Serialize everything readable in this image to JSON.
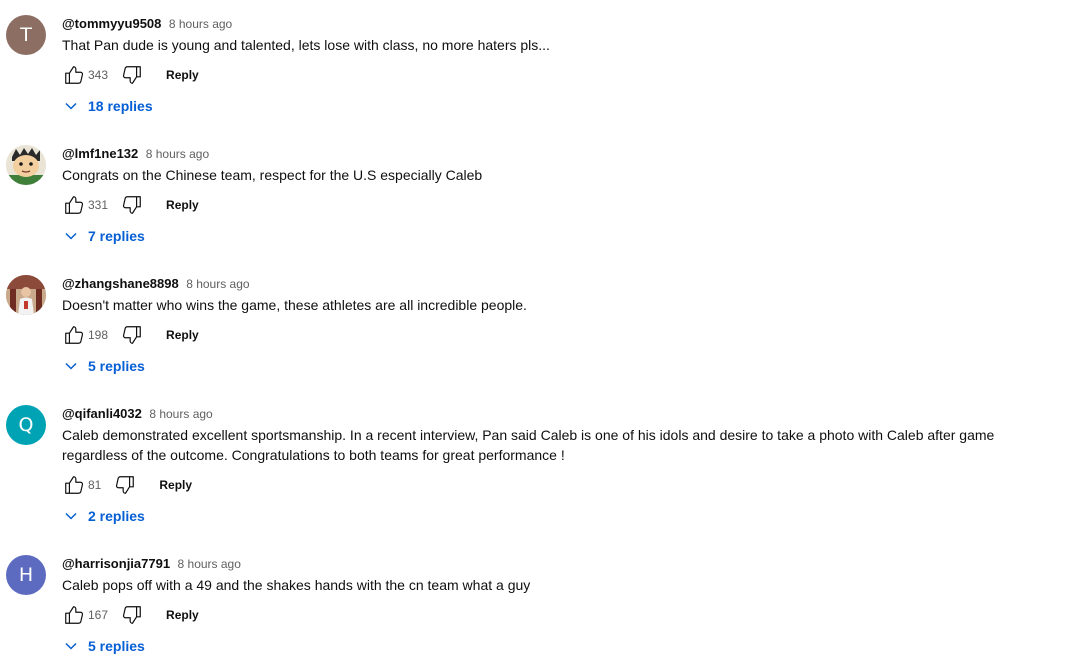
{
  "comments": [
    {
      "author": "@tommyyu9508",
      "time": "8 hours ago",
      "text": "That Pan dude is young and talented, lets lose with class, no more haters pls...",
      "likes": "343",
      "reply_label": "Reply",
      "replies_label": "18 replies",
      "avatar": {
        "type": "letter",
        "letter": "T",
        "color": "#8d6e63"
      }
    },
    {
      "author": "@lmf1ne132",
      "time": "8 hours ago",
      "text": "Congrats on the Chinese team, respect for the U.S especially Caleb",
      "likes": "331",
      "reply_label": "Reply",
      "replies_label": "7 replies",
      "avatar": {
        "type": "image",
        "icon": "cartoon-face-avatar"
      }
    },
    {
      "author": "@zhangshane8898",
      "time": "8 hours ago",
      "text": "Doesn't matter who wins the game, these athletes are all incredible people.",
      "likes": "198",
      "reply_label": "Reply",
      "replies_label": "5 replies",
      "avatar": {
        "type": "image",
        "icon": "photo-avatar"
      }
    },
    {
      "author": "@qifanli4032",
      "time": "8 hours ago",
      "text": "Caleb demonstrated excellent sportsmanship. In a recent interview, Pan said Caleb is one of his idols and desire to take a photo with Caleb after game regardless of the outcome. Congratulations to both teams for great performance !",
      "likes": "81",
      "reply_label": "Reply",
      "replies_label": "2 replies",
      "avatar": {
        "type": "letter",
        "letter": "Q",
        "color": "#00a3b4"
      }
    },
    {
      "author": "@harrisonjia7791",
      "time": "8 hours ago",
      "text": "Caleb pops off with a 49 and the shakes hands with the cn team what a guy",
      "likes": "167",
      "reply_label": "Reply",
      "replies_label": "5 replies",
      "avatar": {
        "type": "letter",
        "letter": "H",
        "color": "#5c6bc0"
      }
    }
  ]
}
